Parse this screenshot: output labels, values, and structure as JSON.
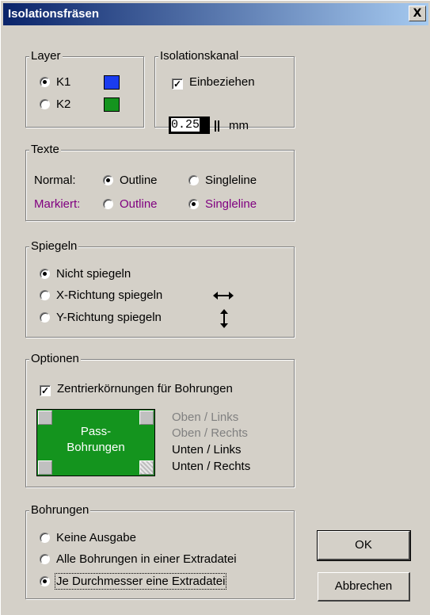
{
  "window": {
    "title": "Isolationsfräsen",
    "close_label": "X"
  },
  "layer": {
    "label": "Layer",
    "options": [
      {
        "label": "K1",
        "checked": true,
        "color": "#1a3cf0"
      },
      {
        "label": "K2",
        "checked": false,
        "color": "#14941e"
      }
    ]
  },
  "isolationskanal": {
    "label": "Isolationskanal",
    "include_label": "Einbeziehen",
    "include_checked": true,
    "value": "0.25",
    "unit": "mm"
  },
  "texte": {
    "label": "Texte",
    "normal_label": "Normal:",
    "marked_label": "Markiert:",
    "outline_label": "Outline",
    "singleline_label": "Singleline",
    "normal_selected": "Outline",
    "marked_selected": "Singleline",
    "marked_color": "#800080"
  },
  "spiegeln": {
    "label": "Spiegeln",
    "options": [
      {
        "label": "Nicht spiegeln",
        "checked": true
      },
      {
        "label": "X-Richtung spiegeln",
        "checked": false,
        "icon": "horizontal-arrow-icon"
      },
      {
        "label": "Y-Richtung spiegeln",
        "checked": false,
        "icon": "vertical-arrow-icon"
      }
    ]
  },
  "optionen": {
    "label": "Optionen",
    "center_punch_label": "Zentrierkörnungen für Bohrungen",
    "center_punch_checked": true,
    "pass_label_line1": "Pass-",
    "pass_label_line2": "Bohrungen",
    "positions": [
      {
        "label": "Oben / Links",
        "enabled": false
      },
      {
        "label": "Oben / Rechts",
        "enabled": false
      },
      {
        "label": "Unten / Links",
        "enabled": true
      },
      {
        "label": "Unten / Rechts",
        "enabled": true
      }
    ]
  },
  "bohrungen": {
    "label": "Bohrungen",
    "options": [
      {
        "label": "Keine Ausgabe",
        "checked": false
      },
      {
        "label": "Alle Bohrungen in einer Extradatei",
        "checked": false
      },
      {
        "label": "Je Durchmesser eine Extradatei",
        "checked": true
      }
    ]
  },
  "buttons": {
    "ok": "OK",
    "cancel": "Abbrechen"
  }
}
